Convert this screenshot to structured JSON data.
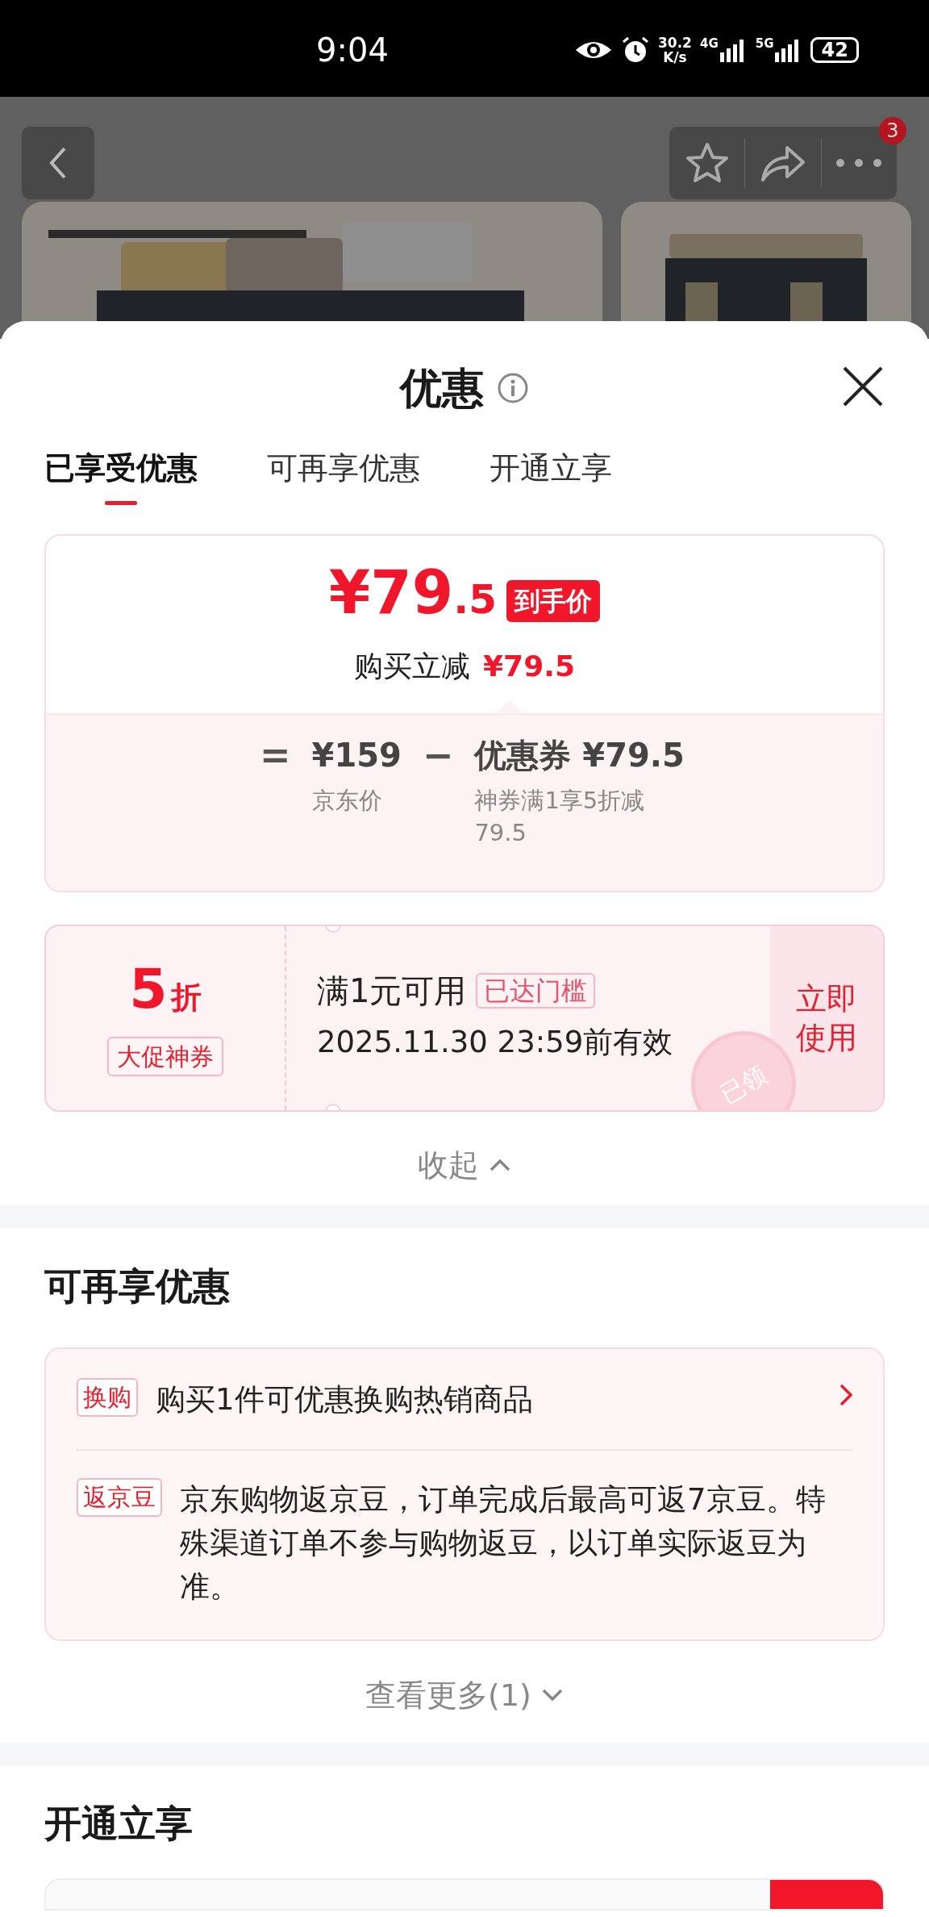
{
  "status_bar": {
    "time": "9:04",
    "net_speed": "30.2",
    "net_unit": "K/s",
    "signals": [
      {
        "label": "4G"
      },
      {
        "label": "5G"
      }
    ],
    "battery": "42"
  },
  "header": {
    "cart_badge": "3"
  },
  "sheet": {
    "title": "优惠",
    "tabs": [
      {
        "label": "已享受优惠",
        "selected": true
      },
      {
        "label": "可再享优惠",
        "selected": false
      },
      {
        "label": "开通立享",
        "selected": false
      }
    ],
    "price_card": {
      "price": {
        "whole": "¥79",
        "fraction": ".5"
      },
      "price_tag": "到手价",
      "saving_label": "购买立减",
      "saving_value": "¥79.5",
      "equals": "=",
      "base_price": "¥159",
      "base_label": "京东价",
      "minus": "−",
      "discount_line": "优惠券 **¥79.5**",
      "discount_note": "神券满1享5折减79.5"
    },
    "coupon": {
      "discount": {
        "value": "5",
        "unit": "折"
      },
      "coupon_type": "大促神券",
      "condition": "满1元可用",
      "condition_badge": "已达门槛",
      "validity": "2025.11.30 23:59前有效",
      "use_button": "立即使用",
      "stamp": "已领"
    },
    "collapse_toggle": {
      "label": "收起",
      "expanded": true
    },
    "more_offers": {
      "heading": "可再享优惠",
      "items": [
        {
          "kind": "link",
          "tag": "换购",
          "text": "购买1件可优惠换购热销商品"
        },
        {
          "kind": "info",
          "tag": "返京豆",
          "text": "京东购物返京豆，订单完成后最高可返7京豆。特殊渠道订单不参与购物返豆，以订单实际返豆为准。"
        }
      ]
    },
    "more_toggle": {
      "label": "查看更多(1)",
      "expanded": false
    },
    "membership": {
      "heading": "开通立享"
    }
  }
}
